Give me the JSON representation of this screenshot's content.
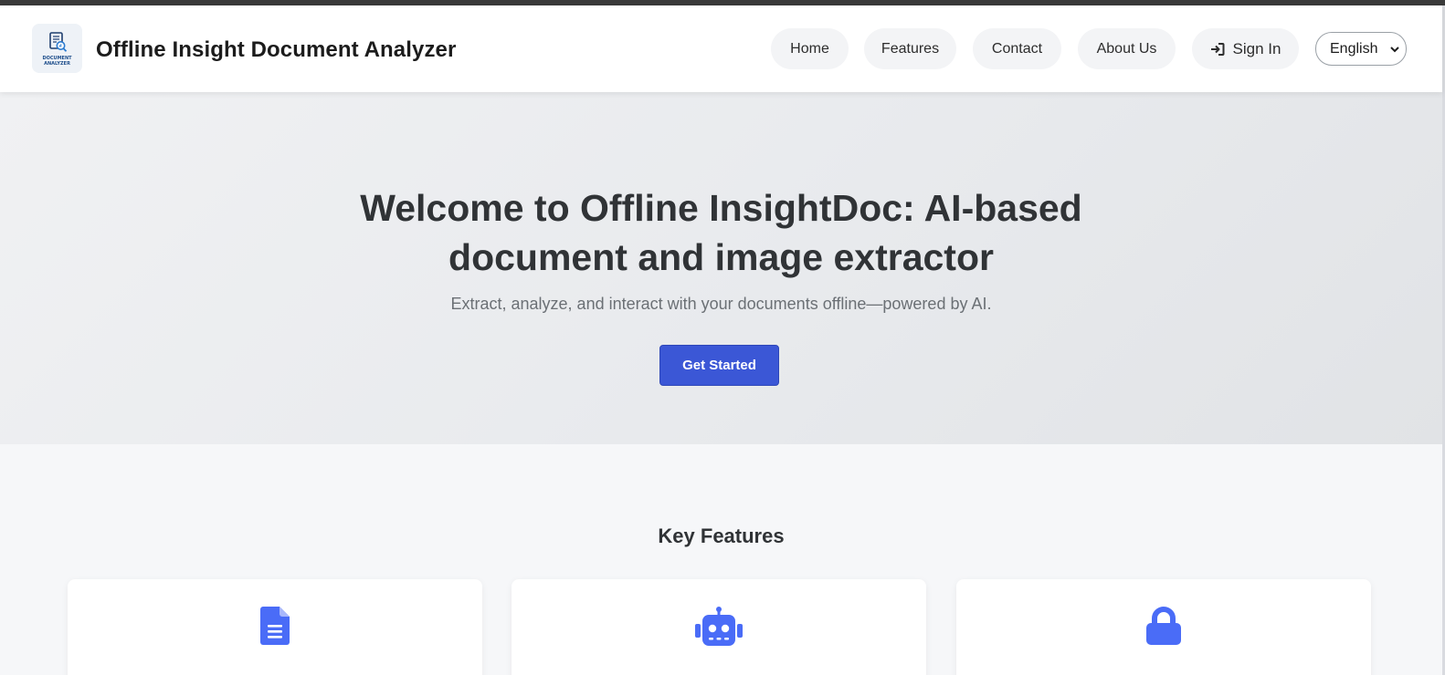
{
  "header": {
    "logo_text_line1": "DOCUMENT",
    "logo_text_line2": "ANALYZER",
    "app_title": "Offline Insight Document Analyzer",
    "nav": {
      "home": "Home",
      "features": "Features",
      "contact": "Contact",
      "about": "About Us",
      "sign_in": "Sign In"
    },
    "language": {
      "selected": "English"
    }
  },
  "hero": {
    "title_line1": "Welcome to Offline InsightDoc: AI-based",
    "title_line2": "document and image extractor",
    "subtitle": "Extract, analyze, and interact with your documents offline—powered by AI.",
    "cta_label": "Get Started"
  },
  "features": {
    "title": "Key Features",
    "cards": [
      {
        "icon": "document-icon"
      },
      {
        "icon": "robot-icon"
      },
      {
        "icon": "lock-icon"
      }
    ]
  },
  "colors": {
    "accent": "#3b57d6",
    "icon": "#4a6cf7",
    "header_bg": "#ffffff",
    "hero_bg": "#e8eaed",
    "title_text": "#303336"
  }
}
